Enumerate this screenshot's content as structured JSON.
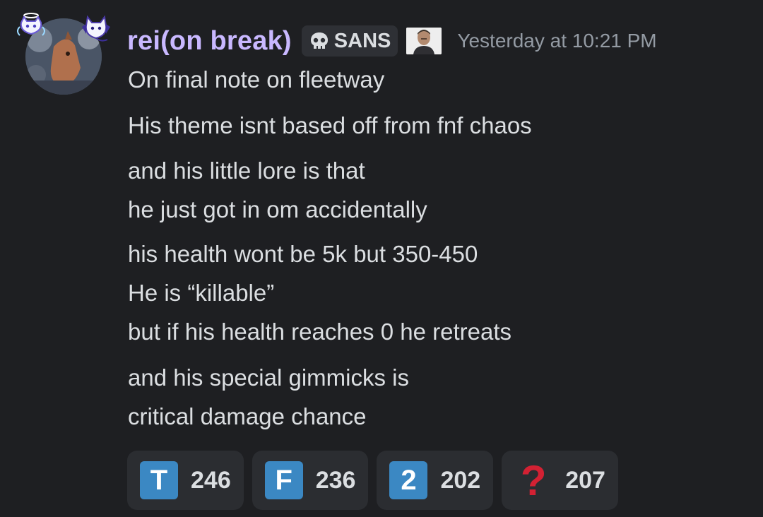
{
  "message": {
    "username": "rei(on break)",
    "username_color": "#c9b8ff",
    "server_tag": {
      "icon": "skull-icon",
      "label": "SANS"
    },
    "profile_badge": "portrait-badge",
    "timestamp": "Yesterday at 10:21 PM",
    "lines": [
      "On final note on fleetway",
      "His theme isnt based off from fnf chaos",
      "and his little lore is that",
      "he just got in om accidentally",
      "his health wont be 5k but 350-450",
      "He is “killable”",
      "but if his health reaches 0 he retreats",
      "and his special gimmicks is",
      "critical damage chance"
    ]
  },
  "reactions": [
    {
      "emoji": "T",
      "icon": "regional-indicator-t-icon",
      "count": "246"
    },
    {
      "emoji": "F",
      "icon": "regional-indicator-f-icon",
      "count": "236"
    },
    {
      "emoji": "2",
      "icon": "keycap-two-icon",
      "count": "202"
    },
    {
      "emoji": "?",
      "icon": "red-question-mark-icon",
      "count": "207"
    }
  ],
  "colors": {
    "background": "#1e1f22",
    "text": "#dbdee1",
    "muted": "#949ba4",
    "reaction_bg": "#2b2d31",
    "emoji_blue": "#3b88c3",
    "question_red": "#d32133"
  }
}
